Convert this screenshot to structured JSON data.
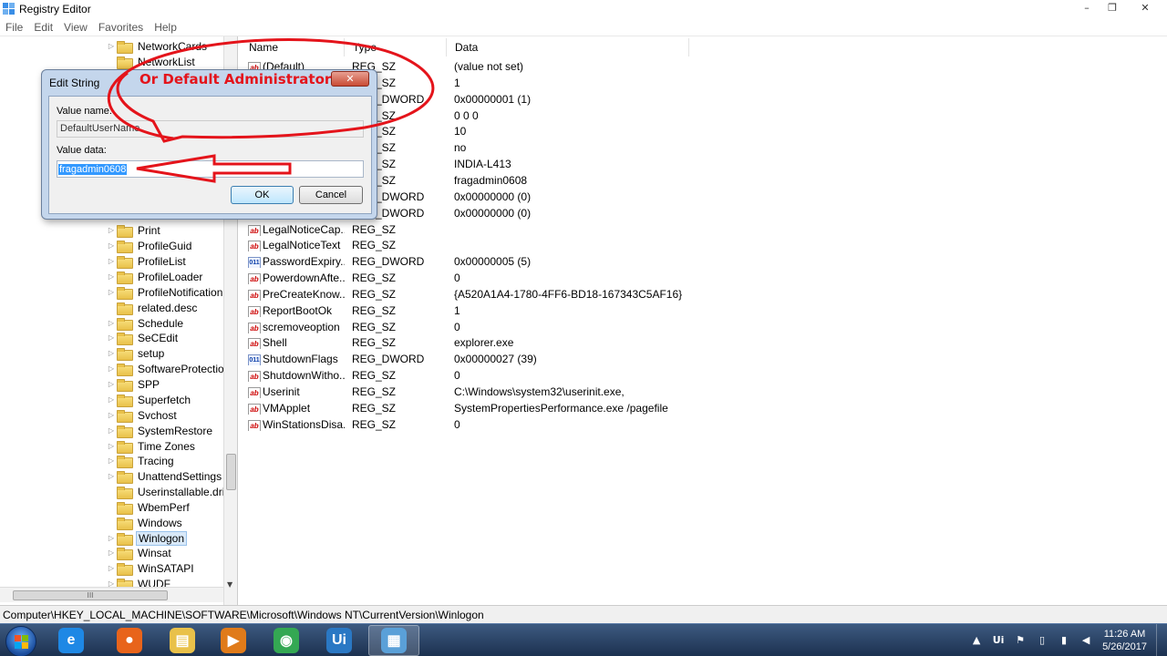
{
  "window": {
    "title": "Registry Editor",
    "controls": {
      "minimize": "–",
      "maximize": "❐",
      "close": "✕"
    }
  },
  "menu": [
    "File",
    "Edit",
    "View",
    "Favorites",
    "Help"
  ],
  "tree": {
    "items": [
      {
        "label": "NetworkCards",
        "arrow": "▷"
      },
      {
        "label": "NetworkList",
        "arrow": ""
      },
      {
        "label": "Print",
        "arrow": "▷"
      },
      {
        "label": "ProfileGuid",
        "arrow": "▷"
      },
      {
        "label": "ProfileList",
        "arrow": "▷"
      },
      {
        "label": "ProfileLoader",
        "arrow": "▷"
      },
      {
        "label": "ProfileNotification",
        "arrow": "▷"
      },
      {
        "label": "related.desc",
        "arrow": ""
      },
      {
        "label": "Schedule",
        "arrow": "▷"
      },
      {
        "label": "SeCEdit",
        "arrow": "▷"
      },
      {
        "label": "setup",
        "arrow": "▷"
      },
      {
        "label": "SoftwareProtection",
        "arrow": "▷"
      },
      {
        "label": "SPP",
        "arrow": "▷"
      },
      {
        "label": "Superfetch",
        "arrow": "▷"
      },
      {
        "label": "Svchost",
        "arrow": "▷"
      },
      {
        "label": "SystemRestore",
        "arrow": "▷"
      },
      {
        "label": "Time Zones",
        "arrow": "▷"
      },
      {
        "label": "Tracing",
        "arrow": "▷"
      },
      {
        "label": "UnattendSettings",
        "arrow": "▷"
      },
      {
        "label": "Userinstallable.drivers",
        "arrow": ""
      },
      {
        "label": "WbemPerf",
        "arrow": ""
      },
      {
        "label": "Windows",
        "arrow": ""
      },
      {
        "label": "Winlogon",
        "arrow": "▷",
        "selected": true
      },
      {
        "label": "Winsat",
        "arrow": "▷"
      },
      {
        "label": "WinSATAPI",
        "arrow": "▷"
      },
      {
        "label": "WUDF",
        "arrow": "▷"
      }
    ],
    "hscroll_grip": "III"
  },
  "list": {
    "columns": [
      "Name",
      "Type",
      "Data"
    ],
    "rows": [
      {
        "name": "(Default)",
        "type": "REG_SZ",
        "data": "(value not set)",
        "icon": "sz"
      },
      {
        "name": "",
        "type": "REG_SZ",
        "data": "1",
        "icon": "sz"
      },
      {
        "name": "",
        "type": "REG_DWORD",
        "data": "0x00000001 (1)",
        "icon": "dw"
      },
      {
        "name": "",
        "type": "REG_SZ",
        "data": "0 0 0",
        "icon": "sz"
      },
      {
        "name": "",
        "type": "REG_SZ",
        "data": "10",
        "icon": "sz"
      },
      {
        "name": "",
        "type": "REG_SZ",
        "data": "no",
        "icon": "sz"
      },
      {
        "name": "",
        "type": "REG_SZ",
        "data": "INDIA-L413",
        "icon": "sz"
      },
      {
        "name": "",
        "type": "REG_SZ",
        "data": "fragadmin0608",
        "icon": "sz"
      },
      {
        "name": "",
        "type": "REG_DWORD",
        "data": "0x00000000 (0)",
        "icon": "dw"
      },
      {
        "name": "",
        "type": "REG_DWORD",
        "data": "0x00000000 (0)",
        "icon": "dw"
      },
      {
        "name": "LegalNoticeCap...",
        "type": "REG_SZ",
        "data": "",
        "icon": "sz"
      },
      {
        "name": "LegalNoticeText",
        "type": "REG_SZ",
        "data": "",
        "icon": "sz"
      },
      {
        "name": "PasswordExpiry...",
        "type": "REG_DWORD",
        "data": "0x00000005 (5)",
        "icon": "dw"
      },
      {
        "name": "PowerdownAfte...",
        "type": "REG_SZ",
        "data": "0",
        "icon": "sz"
      },
      {
        "name": "PreCreateKnow...",
        "type": "REG_SZ",
        "data": "{A520A1A4-1780-4FF6-BD18-167343C5AF16}",
        "icon": "sz"
      },
      {
        "name": "ReportBootOk",
        "type": "REG_SZ",
        "data": "1",
        "icon": "sz"
      },
      {
        "name": "scremoveoption",
        "type": "REG_SZ",
        "data": "0",
        "icon": "sz"
      },
      {
        "name": "Shell",
        "type": "REG_SZ",
        "data": "explorer.exe",
        "icon": "sz"
      },
      {
        "name": "ShutdownFlags",
        "type": "REG_DWORD",
        "data": "0x00000027 (39)",
        "icon": "dw"
      },
      {
        "name": "ShutdownWitho...",
        "type": "REG_SZ",
        "data": "0",
        "icon": "sz"
      },
      {
        "name": "Userinit",
        "type": "REG_SZ",
        "data": "C:\\Windows\\system32\\userinit.exe,",
        "icon": "sz"
      },
      {
        "name": "VMApplet",
        "type": "REG_SZ",
        "data": "SystemPropertiesPerformance.exe /pagefile",
        "icon": "sz"
      },
      {
        "name": "WinStationsDisa...",
        "type": "REG_SZ",
        "data": "0",
        "icon": "sz"
      }
    ],
    "icon_glyphs": {
      "sz": "ab",
      "dw": "011"
    }
  },
  "statusbar": {
    "path": "Computer\\HKEY_LOCAL_MACHINE\\SOFTWARE\\Microsoft\\Windows NT\\CurrentVersion\\Winlogon"
  },
  "dialog": {
    "title": "Edit String",
    "close": "✕",
    "value_name_label": "Value name:",
    "value_name": "DefaultUserName",
    "value_data_label": "Value data:",
    "value_data": "fragadmin0608",
    "ok_label": "OK",
    "cancel_label": "Cancel"
  },
  "annotation": {
    "text": "Or Default Administrator",
    "color": "#e4141b"
  },
  "taskbar": {
    "apps": [
      {
        "name": "internet-explorer",
        "glyph": "e",
        "color": "#1e88e5"
      },
      {
        "name": "firefox",
        "glyph": "●",
        "color": "#e8641b"
      },
      {
        "name": "file-explorer",
        "glyph": "▤",
        "color": "#e9c14a"
      },
      {
        "name": "media-player",
        "glyph": "▶",
        "color": "#e07b1a"
      },
      {
        "name": "chrome",
        "glyph": "◉",
        "color": "#34a853"
      },
      {
        "name": "uipath",
        "glyph": "Ui",
        "color": "#2a78c4"
      },
      {
        "name": "regedit",
        "glyph": "▦",
        "color": "#5aa0d8",
        "active": true
      }
    ],
    "tray": {
      "chevron": "▲",
      "uipath": "Ui",
      "flag": "⚑",
      "battery": "▯",
      "network": "▮",
      "volume": "◀"
    },
    "clock_time": "11:26 AM",
    "clock_date": "5/26/2017"
  }
}
